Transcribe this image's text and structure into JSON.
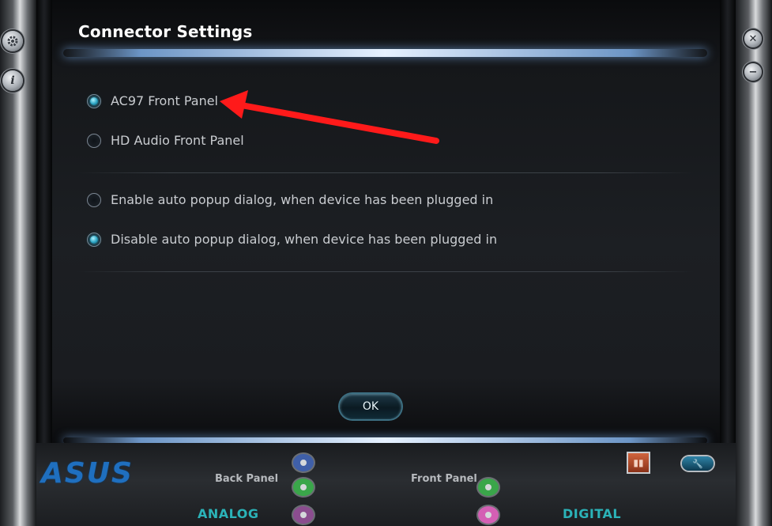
{
  "window": {
    "title": "Connector Settings"
  },
  "connector_options": [
    {
      "label": "AC97 Front Panel",
      "selected": true
    },
    {
      "label": "HD Audio Front Panel",
      "selected": false
    }
  ],
  "popup_options": [
    {
      "label": "Enable auto popup dialog, when device has been plugged in",
      "selected": false
    },
    {
      "label": "Disable auto popup dialog, when device has been plugged in",
      "selected": true
    }
  ],
  "buttons": {
    "ok_label": "OK"
  },
  "bottom_bar": {
    "brand": "ASUS",
    "back_panel_label": "Back Panel",
    "front_panel_label": "Front Panel",
    "analog_label": "ANALOG",
    "digital_label": "DIGITAL"
  },
  "colors": {
    "accent_teal": "#2bb3b8",
    "radio_on": "#37c5e8",
    "arrow": "#ff1a1a",
    "brand_blue": "#1f6fbf",
    "jack_blue": "#3f5fa8",
    "jack_green": "#3aa64a",
    "jack_purple": "#8b4d8f",
    "jack_pink": "#d45fb4"
  },
  "icons": {
    "settings": "gear-icon",
    "info": "info-icon",
    "close": "close-icon",
    "minimize": "minimize-icon",
    "device": "device-icon",
    "tools": "wrench-icon"
  }
}
